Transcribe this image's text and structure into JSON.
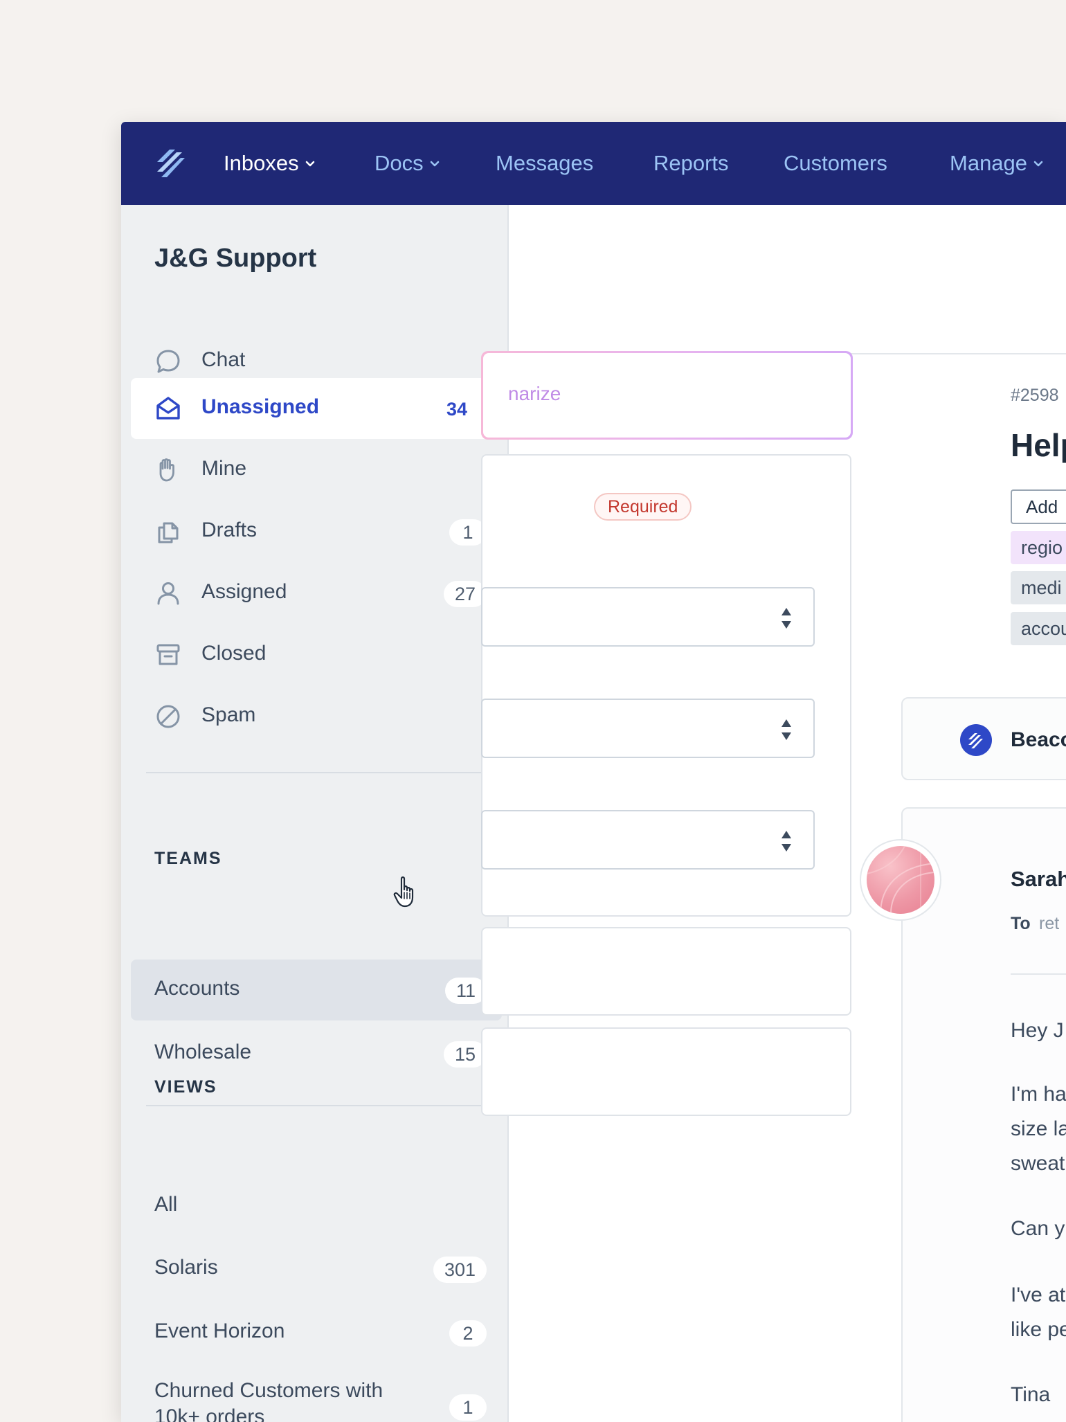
{
  "nav": {
    "items": [
      {
        "label": "Inboxes",
        "dropdown": true,
        "active": true
      },
      {
        "label": "Docs",
        "dropdown": true,
        "active": false
      },
      {
        "label": "Messages",
        "dropdown": false,
        "active": false
      },
      {
        "label": "Reports",
        "dropdown": false,
        "active": false
      },
      {
        "label": "Customers",
        "dropdown": false,
        "active": false
      },
      {
        "label": "Manage",
        "dropdown": true,
        "active": false
      }
    ]
  },
  "sidebar": {
    "title": "J&G Support",
    "folders": [
      {
        "label": "Chat",
        "count": "",
        "icon": "chat-bubble-icon"
      },
      {
        "label": "Unassigned",
        "count": "34",
        "icon": "open-envelope-icon",
        "selected": true
      },
      {
        "label": "Mine",
        "count": "",
        "icon": "hand-icon"
      },
      {
        "label": "Drafts",
        "count": "1",
        "icon": "drafts-icon"
      },
      {
        "label": "Assigned",
        "count": "27",
        "icon": "person-icon"
      },
      {
        "label": "Closed",
        "count": "",
        "icon": "archive-box-icon"
      },
      {
        "label": "Spam",
        "count": "",
        "icon": "no-entry-icon"
      }
    ],
    "teams_heading": "TEAMS",
    "teams": [
      {
        "label": "Accounts",
        "count": "11"
      },
      {
        "label": "Wholesale",
        "count": "15"
      }
    ],
    "views_heading": "VIEWS",
    "views": [
      {
        "label": "All",
        "count": ""
      },
      {
        "label": "Solaris",
        "count": "301"
      },
      {
        "label": "Event Horizon",
        "count": "2"
      },
      {
        "label": "Churned Customers with 10k+ orders",
        "count": "1"
      }
    ]
  },
  "middle": {
    "ai_summarize_partial": "narize",
    "required_badge": "Required"
  },
  "ticket": {
    "number_partial": "#2598",
    "subject_partial": "Help",
    "add_tag_partial": "Add",
    "tags_partial": [
      "regio",
      "medi",
      "accou"
    ],
    "beacon_partial": "Beaco",
    "sender_partial": "Sarah",
    "to_label": "To",
    "to_value_partial": "ret",
    "body_lines_partial": [
      "Hey J",
      "I'm ha",
      "size la",
      "sweat",
      "Can y",
      "I've at",
      "like pe",
      "Tina"
    ]
  },
  "colors": {
    "nav_bg": "#1f2875",
    "nav_text": "#9cc4f5",
    "accent": "#2e48c7",
    "sidebar_bg": "#eef0f2",
    "required": "#c3372d",
    "tag_region": "#f2e3fb",
    "tag_neutral": "#e4e8ec"
  }
}
